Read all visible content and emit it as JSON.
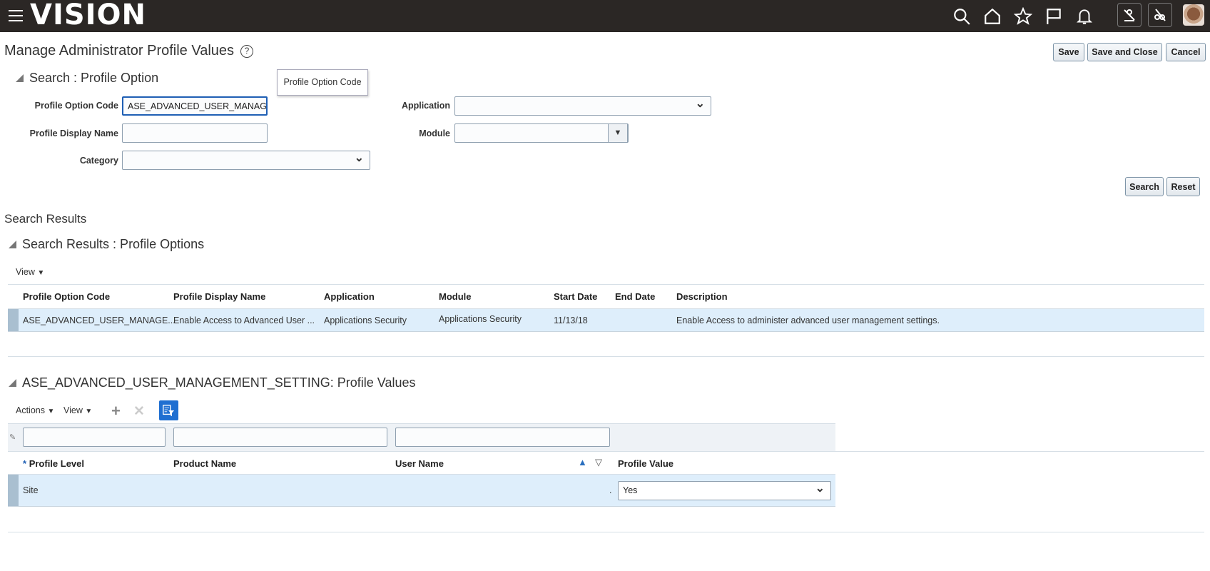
{
  "header": {
    "logo": "VISION",
    "icons": [
      "menu-icon",
      "search-icon",
      "home-icon",
      "favorites-star-icon",
      "watchlist-flag-icon",
      "notifications-bell-icon",
      "accessibility-icon",
      "disconnect-icon",
      "user-avatar"
    ]
  },
  "page": {
    "title": "Manage Administrator Profile Values",
    "help": "?",
    "save": "Save",
    "save_close": "Save and Close",
    "cancel": "Cancel"
  },
  "search": {
    "title": "Search : Profile Option",
    "tooltip": "Profile Option Code",
    "profile_option_code_label": "Profile Option Code",
    "profile_option_code_value": "ASE_ADVANCED_USER_MANAGEM",
    "profile_display_name_label": "Profile Display Name",
    "profile_display_name_value": "",
    "category_label": "Category",
    "category_value": "",
    "application_label": "Application",
    "application_value": "",
    "module_label": "Module",
    "module_value": "",
    "search_button": "Search",
    "reset_button": "Reset"
  },
  "results": {
    "heading": "Search Results",
    "title": "Search Results : Profile Options",
    "view": "View",
    "columns": [
      "Profile Option Code",
      "Profile Display Name",
      "Application",
      "Module",
      "Start Date",
      "End Date",
      "Description"
    ],
    "rows": [
      [
        "ASE_ADVANCED_USER_MANAGE...",
        "Enable Access to Advanced User ...",
        "Applications Security",
        "Applications Security",
        "11/13/18",
        "",
        "Enable Access to administer advanced user management settings."
      ]
    ]
  },
  "values": {
    "title": "ASE_ADVANCED_USER_MANAGEMENT_SETTING: Profile Values",
    "actions": "Actions",
    "view": "View",
    "required_mark": "*",
    "columns": [
      "Profile Level",
      "Product Name",
      "User Name",
      "Profile Value"
    ],
    "rows": [
      {
        "level": "Site",
        "product": "",
        "user": ".",
        "value": "Yes"
      }
    ]
  }
}
